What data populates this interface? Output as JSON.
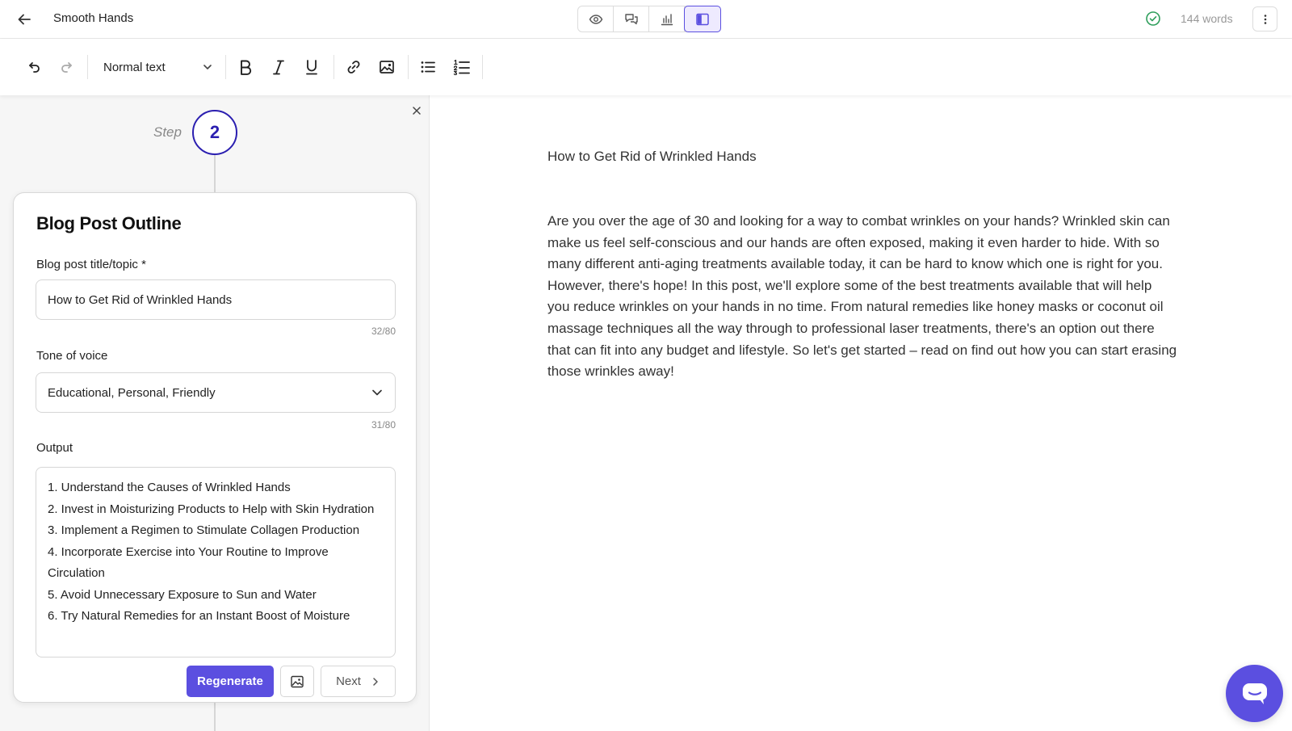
{
  "header": {
    "title": "Smooth Hands",
    "word_count": "144 words"
  },
  "toolbar": {
    "text_style": "Normal text"
  },
  "panel": {
    "step_label": "Step",
    "step_number": "2",
    "card_title": "Blog Post Outline",
    "title_field": {
      "label": "Blog post title/topic *",
      "value": "How to Get Rid of Wrinkled Hands",
      "counter": "32/80"
    },
    "tone_field": {
      "label": "Tone of voice",
      "value": "Educational, Personal, Friendly",
      "counter": "31/80"
    },
    "output": {
      "label": "Output",
      "lines": [
        "1. Understand the Causes of Wrinkled Hands",
        "2. Invest in Moisturizing Products to Help with Skin Hydration",
        "3. Implement a Regimen to Stimulate Collagen Production",
        "4. Incorporate Exercise into Your Routine to Improve Circulation",
        "5. Avoid Unnecessary Exposure to Sun and Water",
        "6. Try Natural Remedies for an Instant Boost of Moisture"
      ]
    },
    "regenerate_label": "Regenerate",
    "next_label": "Next"
  },
  "editor": {
    "heading": "How to Get Rid of Wrinkled Hands",
    "body": "Are you over the age of 30 and looking for a way to combat wrinkles on your hands? Wrinkled skin can make us feel self-conscious and our hands are often exposed, making it even harder to hide. With so many different anti-aging treatments available today, it can be hard to know which one is right for you. However, there's hope! In this post, we'll explore some of the best treatments available that will help you reduce wrinkles on your hands in no time. From natural remedies like honey masks or coconut oil massage techniques all the way through to professional laser treatments, there's an option out there that can fit into any budget and lifestyle. So let's get started – read on find out how you can start erasing those wrinkles away!"
  },
  "colors": {
    "accent": "#5b4fe0",
    "step_circle": "#2b1fb0",
    "saved_check": "#2e9e5b"
  }
}
